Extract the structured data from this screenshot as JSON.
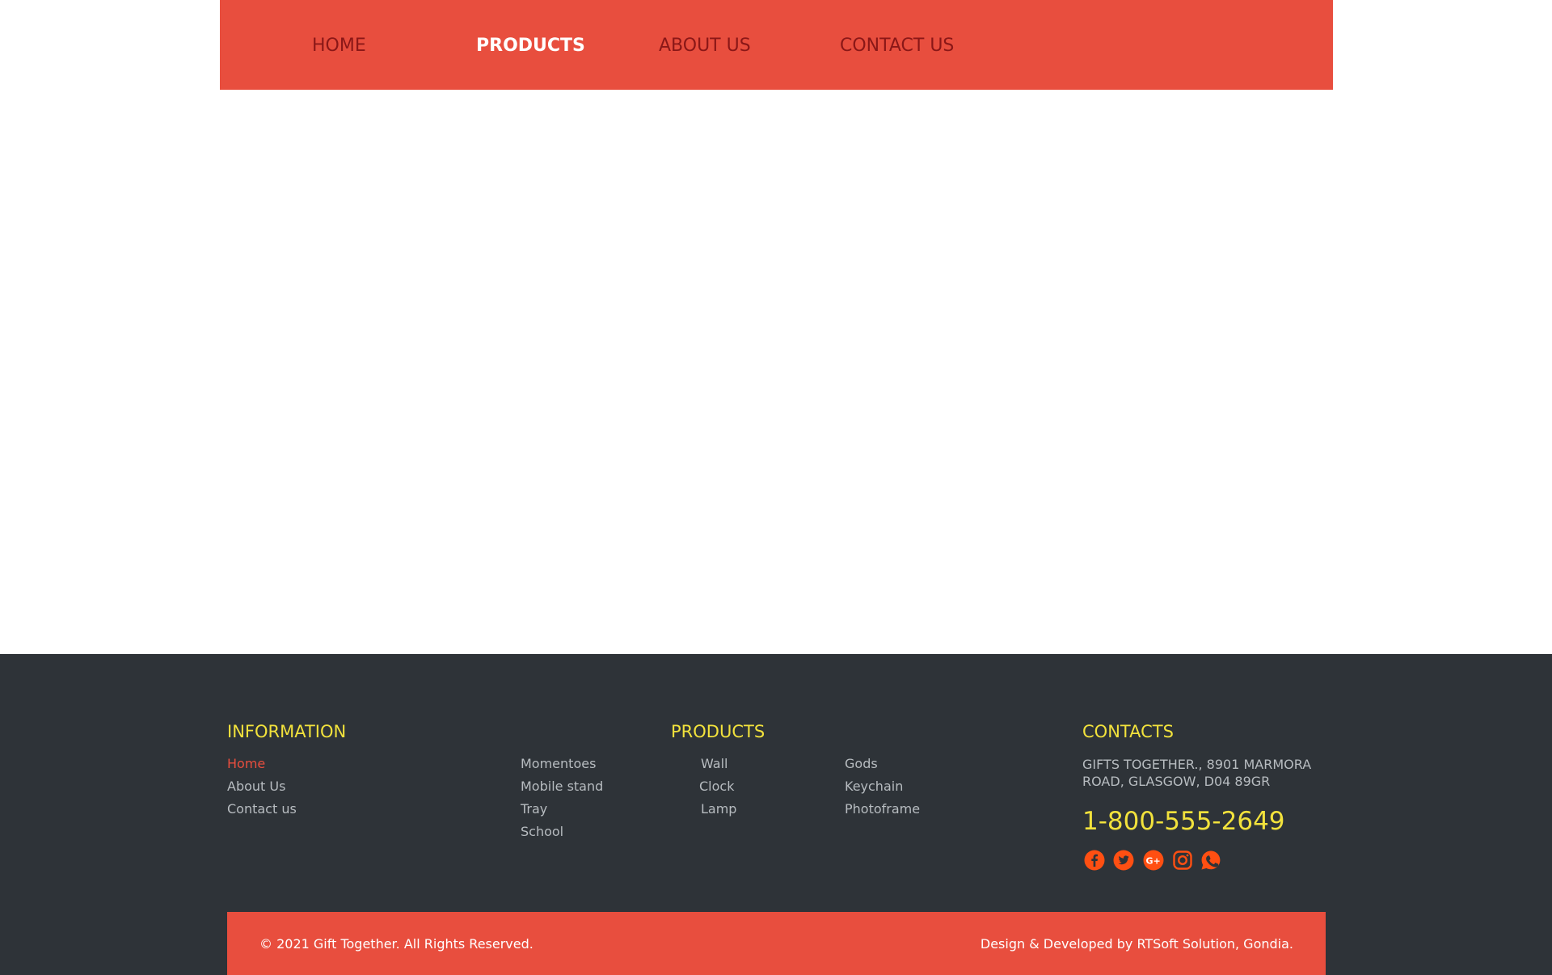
{
  "nav": {
    "home": "HOME",
    "products": "PRODUCTS",
    "about": "ABOUT US",
    "contact": "CONTACT US"
  },
  "footer": {
    "information": {
      "heading": "INFORMATION",
      "links": [
        "Home",
        "About Us",
        "Contact us"
      ]
    },
    "products": {
      "heading": "PRODUCTS",
      "col1": [
        "Momentoes",
        "Mobile stand",
        "Tray",
        "School"
      ],
      "col2": [
        "Wall",
        "Clock",
        "Lamp"
      ],
      "col3": [
        "Gods",
        "Keychain",
        "Photoframe"
      ]
    },
    "contacts": {
      "heading": "CONTACTS",
      "address": "GIFTS TOGETHER., 8901 MARMORA ROAD, GLASGOW, D04 89GR",
      "phone": "1-800-555-2649"
    },
    "social_icons": [
      "facebook-icon",
      "twitter-icon",
      "google-plus-icon",
      "instagram-icon",
      "whatsapp-icon"
    ],
    "copyright": "© 2021 Gift Together. All Rights Reserved.",
    "credit": "Design & Developed by RTSoft Solution, Gondia."
  },
  "colors": {
    "accent": "#e84e3e",
    "footer_bg": "#2e3338",
    "heading": "#f2e23c",
    "link": "#b7bcc0",
    "social": "#ff4f12"
  }
}
